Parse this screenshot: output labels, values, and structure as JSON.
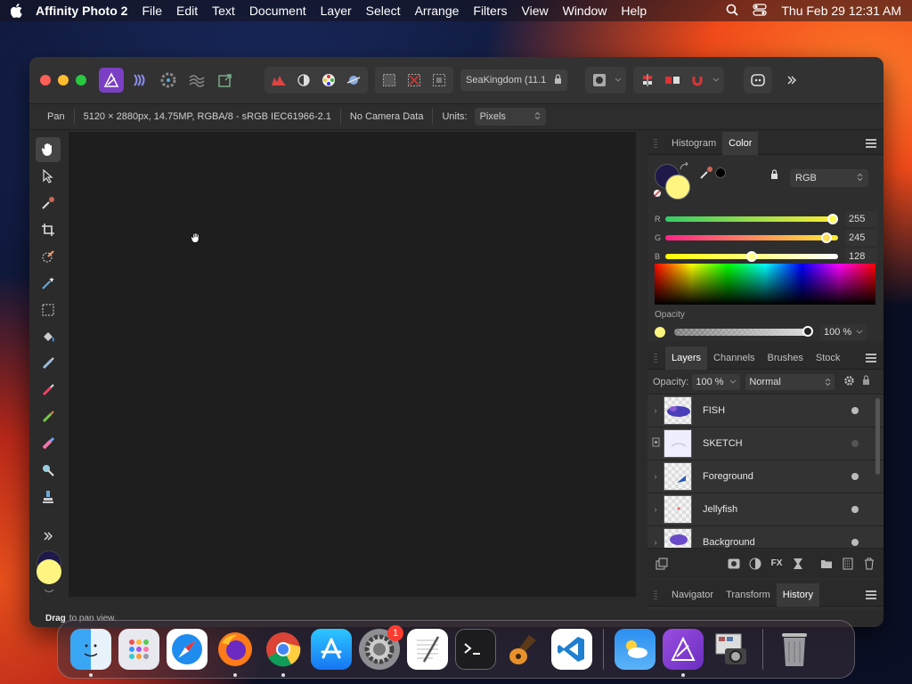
{
  "menubar": {
    "app_name": "Affinity Photo 2",
    "items": [
      "File",
      "Edit",
      "Text",
      "Document",
      "Layer",
      "Select",
      "Arrange",
      "Filters",
      "View",
      "Window",
      "Help"
    ],
    "clock": "Thu Feb 29  12:31 AM"
  },
  "toolbar": {
    "document_name": "SeaKingdom (11.1"
  },
  "context_bar": {
    "tool": "Pan",
    "image_info": "5120 × 2880px, 14.75MP, RGBA/8 - sRGB IEC61966-2.1",
    "camera": "No Camera Data",
    "units_label": "Units:",
    "units_value": "Pixels"
  },
  "color_panel": {
    "tabs": [
      "Histogram",
      "Color"
    ],
    "active_tab": "Color",
    "mode": "RGB",
    "foreground": "#fff580",
    "background": "#1d1a4a",
    "channels": [
      {
        "label": "R",
        "value": "255",
        "fraction": 1.0
      },
      {
        "label": "G",
        "value": "245",
        "fraction": 0.96
      },
      {
        "label": "B",
        "value": "128",
        "fraction": 0.5
      }
    ],
    "opacity_label": "Opacity",
    "opacity_value": "100 %"
  },
  "layers_panel": {
    "tabs": [
      "Layers",
      "Channels",
      "Brushes",
      "Stock"
    ],
    "active_tab": "Layers",
    "opacity_label": "Opacity:",
    "opacity_value": "100 %",
    "blend_mode": "Normal",
    "layers": [
      {
        "name": "FISH",
        "visible": true
      },
      {
        "name": "SKETCH",
        "visible": false
      },
      {
        "name": "Foreground",
        "visible": true
      },
      {
        "name": "Jellyfish",
        "visible": true
      },
      {
        "name": "Background",
        "visible": true
      }
    ]
  },
  "nav_panel": {
    "tabs": [
      "Navigator",
      "Transform",
      "History"
    ],
    "active_tab": "History"
  },
  "status": {
    "bold": "Drag",
    "text": "to pan view."
  },
  "dock": {
    "settings_badge": "1"
  }
}
